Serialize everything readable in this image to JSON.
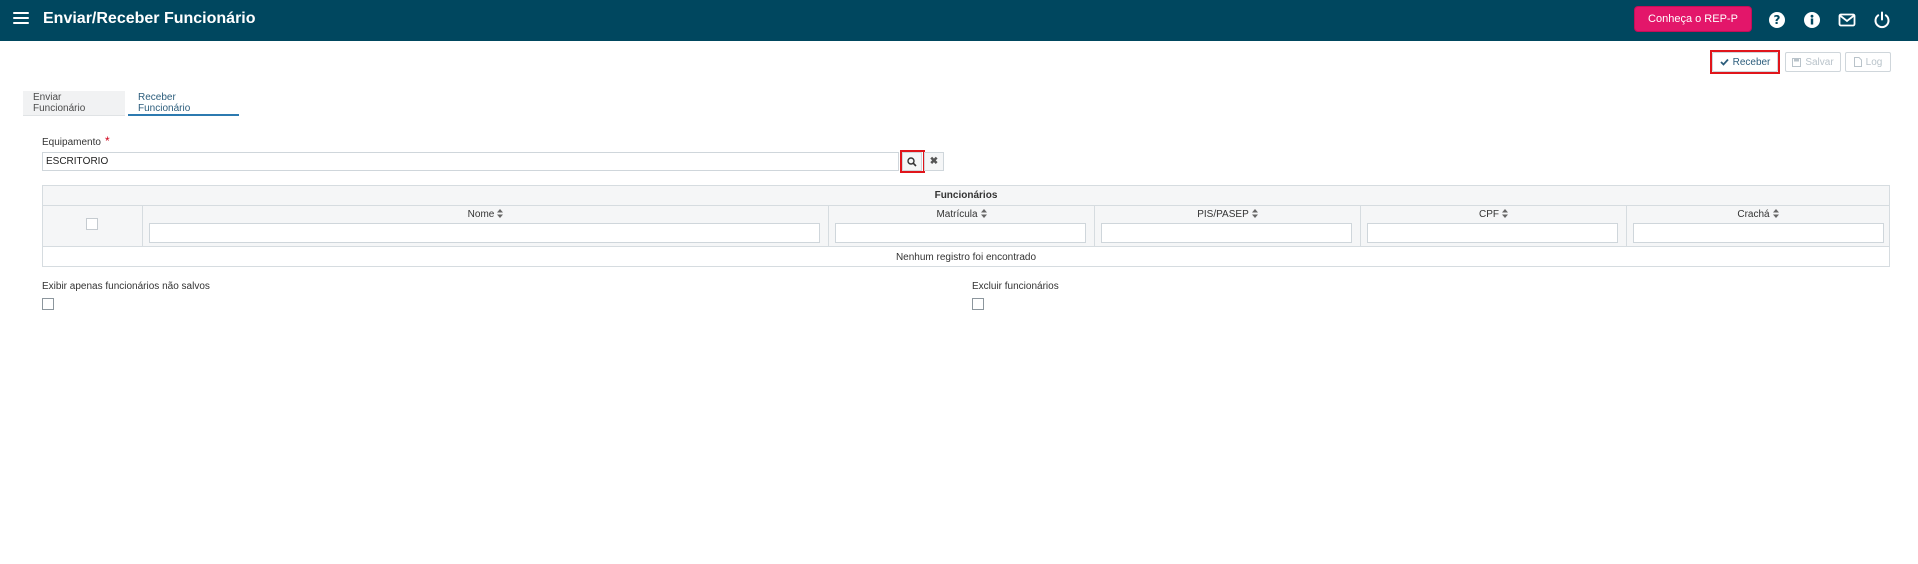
{
  "header": {
    "title": "Enviar/Receber Funcionário",
    "promo_label": "Conheça o REP-P",
    "icons": [
      "question-icon",
      "info-icon",
      "mail-icon",
      "power-icon"
    ]
  },
  "toolbar": {
    "receive_label": "Receber",
    "save_label": "Salvar",
    "log_label": "Log"
  },
  "tabs": [
    {
      "label": "Enviar Funcionário",
      "active": false
    },
    {
      "label": "Receber Funcionário",
      "active": true
    }
  ],
  "equipment_field": {
    "label": "Equipamento",
    "required_mark": "*",
    "value": "ESCRITÓRIO"
  },
  "grid": {
    "caption": "Funcionários",
    "columns": [
      "Nome",
      "Matrícula",
      "PIS/PASEP",
      "CPF",
      "Crachá"
    ],
    "empty_message": "Nenhum registro foi encontrado"
  },
  "options": {
    "only_unsaved_label": "Exibir apenas funcionários não salvos",
    "exclude_label": "Excluir funcionários"
  },
  "colors": {
    "header_bg": "#00475f",
    "promo_bg": "#e3166a",
    "highlight": "#e0151b",
    "accent": "#2c7ab0"
  }
}
